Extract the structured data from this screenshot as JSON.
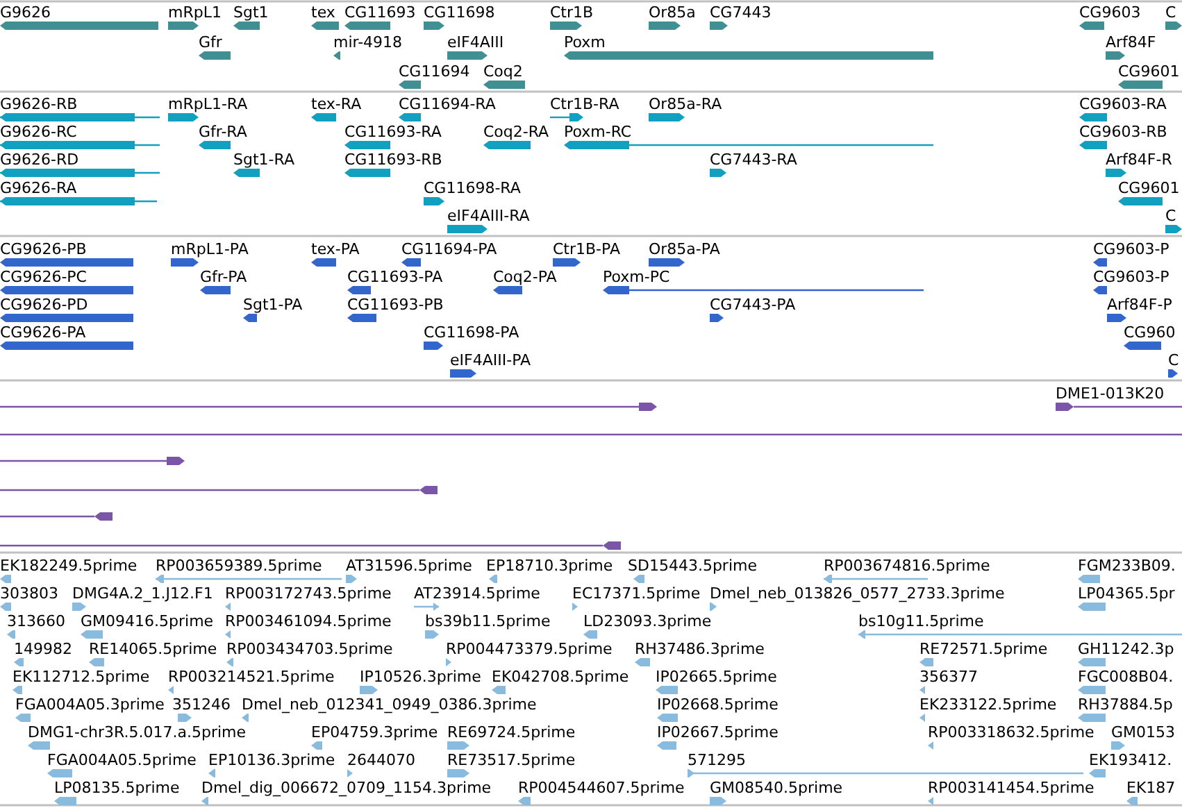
{
  "tracks": [
    {
      "color": "#3f8f93",
      "features": [
        {
          "label": "G9626",
          "reverse": true
        },
        {
          "label": "mRpL1",
          "reverse": false
        },
        {
          "label": "Sgt1",
          "reverse": true
        },
        {
          "label": "tex",
          "reverse": true
        },
        {
          "label": "CG11693",
          "reverse": true
        },
        {
          "label": "CG11698",
          "reverse": false
        },
        {
          "label": "Ctr1B",
          "reverse": false
        },
        {
          "label": "Or85a",
          "reverse": false
        },
        {
          "label": "CG7443",
          "reverse": false
        },
        {
          "label": "CG9603",
          "reverse": true
        },
        {
          "label": "C",
          "reverse": false
        },
        {
          "label": "Gfr",
          "reverse": true
        },
        {
          "label": "mir-4918",
          "reverse": true
        },
        {
          "label": "eIF4AIII",
          "reverse": false
        },
        {
          "label": "Poxm",
          "reverse": true
        },
        {
          "label": "Arf84F",
          "reverse": false
        },
        {
          "label": "CG11694",
          "reverse": true
        },
        {
          "label": "Coq2",
          "reverse": true
        },
        {
          "label": "CG9601",
          "reverse": true
        }
      ]
    },
    {
      "color": "#12a0c0",
      "features": [
        {
          "label": "G9626-RB",
          "reverse": true
        },
        {
          "label": "mRpL1-RA",
          "reverse": false
        },
        {
          "label": "tex-RA",
          "reverse": true
        },
        {
          "label": "CG11694-RA",
          "reverse": true
        },
        {
          "label": "Ctr1B-RA",
          "reverse": false
        },
        {
          "label": "Or85a-RA",
          "reverse": false
        },
        {
          "label": "CG9603-RA",
          "reverse": true
        },
        {
          "label": "G9626-RC",
          "reverse": true
        },
        {
          "label": "Gfr-RA",
          "reverse": true
        },
        {
          "label": "CG11693-RA",
          "reverse": true
        },
        {
          "label": "Coq2-RA",
          "reverse": true
        },
        {
          "label": "Poxm-RC",
          "reverse": true
        },
        {
          "label": "CG9603-RB",
          "reverse": true
        },
        {
          "label": "G9626-RD",
          "reverse": true
        },
        {
          "label": "Sgt1-RA",
          "reverse": true
        },
        {
          "label": "CG11693-RB",
          "reverse": true
        },
        {
          "label": "CG7443-RA",
          "reverse": false
        },
        {
          "label": "Arf84F-R",
          "reverse": false
        },
        {
          "label": "G9626-RA",
          "reverse": true
        },
        {
          "label": "CG11698-RA",
          "reverse": false
        },
        {
          "label": "CG9601",
          "reverse": true
        },
        {
          "label": "eIF4AIII-RA",
          "reverse": false
        },
        {
          "label": "C",
          "reverse": false
        }
      ]
    },
    {
      "color": "#3366cc",
      "features": [
        {
          "label": "CG9626-PB",
          "reverse": true
        },
        {
          "label": "mRpL1-PA",
          "reverse": false
        },
        {
          "label": "tex-PA",
          "reverse": true
        },
        {
          "label": "CG11694-PA",
          "reverse": true
        },
        {
          "label": "Ctr1B-PA",
          "reverse": false
        },
        {
          "label": "Or85a-PA",
          "reverse": false
        },
        {
          "label": "CG9603-P",
          "reverse": true
        },
        {
          "label": "CG9626-PC",
          "reverse": true
        },
        {
          "label": "Gfr-PA",
          "reverse": true
        },
        {
          "label": "CG11693-PA",
          "reverse": true
        },
        {
          "label": "Coq2-PA",
          "reverse": true
        },
        {
          "label": "Poxm-PC",
          "reverse": true
        },
        {
          "label": "CG9603-P",
          "reverse": true
        },
        {
          "label": "CG9626-PD",
          "reverse": true
        },
        {
          "label": "Sgt1-PA",
          "reverse": true
        },
        {
          "label": "CG11693-PB",
          "reverse": true
        },
        {
          "label": "CG7443-PA",
          "reverse": false
        },
        {
          "label": "Arf84F-P",
          "reverse": false
        },
        {
          "label": "CG9626-PA",
          "reverse": true
        },
        {
          "label": "CG11698-PA",
          "reverse": false
        },
        {
          "label": "CG960",
          "reverse": true
        },
        {
          "label": "eIF4AIII-PA",
          "reverse": false
        },
        {
          "label": "C",
          "reverse": false
        }
      ]
    },
    {
      "color": "#7b55a8",
      "features": [
        {
          "kind": "arrow",
          "reverse": false
        },
        {
          "kind": "arrow",
          "label": "DME1-013K20",
          "reverse": false
        },
        {
          "kind": "line"
        },
        {
          "kind": "arrow",
          "reverse": false
        },
        {
          "kind": "arrow",
          "reverse": true
        },
        {
          "kind": "arrow",
          "reverse": true
        },
        {
          "kind": "arrow",
          "reverse": true
        }
      ]
    },
    {
      "color": "#88bbdd",
      "features": [
        {
          "label": "EK182249.5prime",
          "reverse": true
        },
        {
          "label": "RP003659389.5prime",
          "reverse": true
        },
        {
          "label": "AT31596.5prime",
          "reverse": false
        },
        {
          "label": "EP18710.3prime",
          "reverse": true
        },
        {
          "label": "SD15443.5prime",
          "reverse": true
        },
        {
          "label": "RP003674816.5prime",
          "reverse": true
        },
        {
          "label": "FGM233B09.",
          "reverse": true
        },
        {
          "label": "303803",
          "reverse": true
        },
        {
          "label": "DMG4A.2_1.J12.F1",
          "reverse": false
        },
        {
          "label": "RP003172743.5prime",
          "reverse": true
        },
        {
          "label": "AT23914.5prime",
          "reverse": false
        },
        {
          "label": "EC17371.5prime",
          "reverse": false
        },
        {
          "label": "Dmel_neb_013826_0577_2733.3prime",
          "reverse": false
        },
        {
          "label": "LP04365.5pr",
          "reverse": true
        },
        {
          "label": "313660",
          "reverse": true
        },
        {
          "label": "GM09416.5prime",
          "reverse": true
        },
        {
          "label": "RP003461094.5prime",
          "reverse": true
        },
        {
          "label": "bs39b11.5prime",
          "reverse": false
        },
        {
          "label": "LD23093.3prime",
          "reverse": true
        },
        {
          "label": "bs10g11.5prime",
          "reverse": true
        },
        {
          "label": "149982",
          "reverse": true
        },
        {
          "label": "RE14065.5prime",
          "reverse": true
        },
        {
          "label": "RP003434703.5prime",
          "reverse": true
        },
        {
          "label": "RP004473379.5prime",
          "reverse": false
        },
        {
          "label": "RH37486.3prime",
          "reverse": true
        },
        {
          "label": "RE72571.5prime",
          "reverse": true
        },
        {
          "label": "GH11242.3p",
          "reverse": true
        },
        {
          "label": "EK112712.5prime",
          "reverse": true
        },
        {
          "label": "RP003214521.5prime",
          "reverse": true
        },
        {
          "label": "IP10526.3prime",
          "reverse": false
        },
        {
          "label": "EK042708.5prime",
          "reverse": true
        },
        {
          "label": "IP02665.5prime",
          "reverse": true
        },
        {
          "label": "356377",
          "reverse": true
        },
        {
          "label": "FGC008B04.",
          "reverse": true
        },
        {
          "label": "FGA004A05.3prime",
          "reverse": true
        },
        {
          "label": "351246",
          "reverse": false
        },
        {
          "label": "Dmel_neb_012341_0949_0386.3prime",
          "reverse": true
        },
        {
          "label": "IP02668.5prime",
          "reverse": true
        },
        {
          "label": "EK233122.5prime",
          "reverse": true
        },
        {
          "label": "RH37884.5p",
          "reverse": true
        },
        {
          "label": "DMG1-chr3R.5.017.a.5prime",
          "reverse": true
        },
        {
          "label": "EP04759.3prime",
          "reverse": true
        },
        {
          "label": "RE69724.5prime",
          "reverse": false
        },
        {
          "label": "IP02667.5prime",
          "reverse": true
        },
        {
          "label": "RP003318632.5prime",
          "reverse": true
        },
        {
          "label": "GM0153",
          "reverse": false
        },
        {
          "label": "FGA004A05.5prime",
          "reverse": true
        },
        {
          "label": "EP10136.3prime",
          "reverse": true
        },
        {
          "label": "2644070",
          "reverse": false
        },
        {
          "label": "RE73517.5prime",
          "reverse": false
        },
        {
          "label": "571295",
          "reverse": false
        },
        {
          "label": "EK193412.",
          "reverse": true
        },
        {
          "label": "LP08135.5prime",
          "reverse": true
        },
        {
          "label": "Dmel_dig_006672_0709_1154.3prime",
          "reverse": true
        },
        {
          "label": "RP004544607.5prime",
          "reverse": true
        },
        {
          "label": "GM08540.5prime",
          "reverse": false
        },
        {
          "label": "RP003141454.5prime",
          "reverse": true
        },
        {
          "label": "EK187",
          "reverse": true
        }
      ]
    }
  ]
}
